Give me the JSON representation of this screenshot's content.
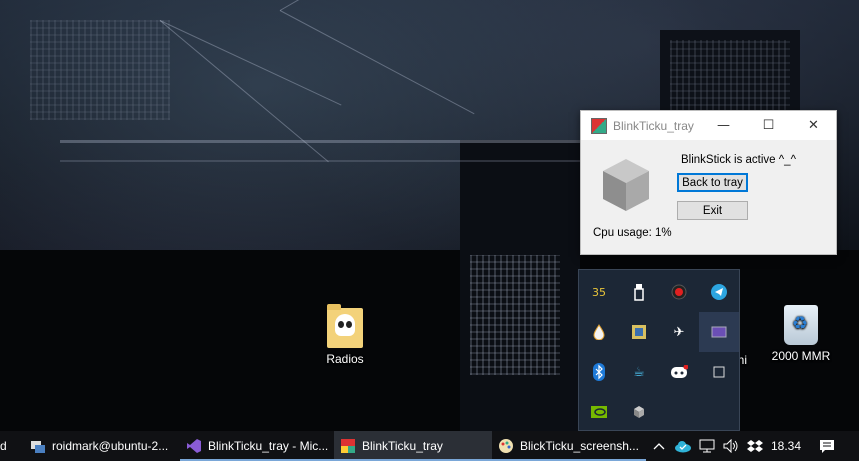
{
  "desktop": {
    "icons": [
      {
        "label": "Radios",
        "icon": "skull-folder-icon"
      },
      {
        "label": "2000 MMR",
        "icon": "recycle-bin-icon"
      },
      {
        "label": "ini",
        "icon": "partial-icon"
      }
    ]
  },
  "app_window": {
    "title": "BlinkTicku_tray",
    "controls": {
      "minimize": "—",
      "maximize": "☐",
      "close": "✕"
    },
    "status_text": "BlinkStick is active ^_^",
    "back_to_tray_label": "Back to tray",
    "exit_label": "Exit",
    "cpu_label": "Cpu usage:",
    "cpu_value": "1%"
  },
  "tray_popup": {
    "badge_number": "35",
    "items": [
      "number-badge-icon",
      "usb-drive-icon",
      "record-icon",
      "telegram-icon",
      "water-drop-icon",
      "grid-app-icon",
      "airplane-icon",
      "monitor-icon",
      "bluetooth-icon",
      "coffee-cup-icon",
      "discord-icon",
      "window-icon",
      "nvidia-icon",
      "cube-icon"
    ]
  },
  "taskbar": {
    "partial_left": "d",
    "items": [
      {
        "label": "roidmark@ubuntu-2...",
        "icon": "putty-icon"
      },
      {
        "label": "BlinkTicku_tray - Mic...",
        "icon": "visual-studio-icon"
      },
      {
        "label": "BlinkTicku_tray",
        "icon": "app-icon"
      },
      {
        "label": "BlickTicku_screensh...",
        "icon": "paint-icon"
      }
    ],
    "clock": "18.34",
    "system_icons": [
      "chevron-up-icon",
      "onedrive-icon",
      "network-icon",
      "volume-icon",
      "dropbox-icon",
      "notifications-icon"
    ]
  }
}
